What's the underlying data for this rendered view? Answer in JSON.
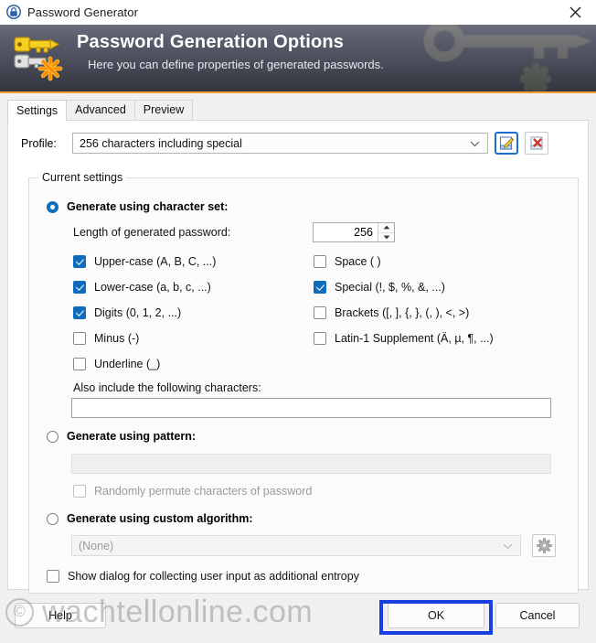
{
  "window": {
    "title": "Password Generator",
    "icon": "padlock-icon",
    "close_label": "✕"
  },
  "banner": {
    "title": "Password Generation Options",
    "subtitle": "Here you can define properties of generated passwords.",
    "icon": "key-star-icon",
    "accent_color": "#f0a030",
    "bg_top": "#6a6d7c",
    "bg_bottom": "#32343d"
  },
  "tabs": [
    {
      "label": "Settings",
      "active": true
    },
    {
      "label": "Advanced",
      "active": false
    },
    {
      "label": "Preview",
      "active": false
    }
  ],
  "profile": {
    "label": "Profile:",
    "value": "256 characters including special",
    "edit_button_icon": "edit-profile-icon",
    "delete_button_icon": "delete-profile-icon"
  },
  "group": {
    "title": "Current settings"
  },
  "charset_option": {
    "label": "Generate using character set:",
    "selected": true,
    "length_label": "Length of generated password:",
    "length_value": "256",
    "checkboxes_left": [
      {
        "label": "Upper-case (A, B, C, ...)",
        "checked": true
      },
      {
        "label": "Lower-case (a, b, c, ...)",
        "checked": true
      },
      {
        "label": "Digits (0, 1, 2, ...)",
        "checked": true
      },
      {
        "label": "Minus (-)",
        "checked": false
      },
      {
        "label": "Underline (_)",
        "checked": false
      }
    ],
    "checkboxes_right": [
      {
        "label": "Space ( )",
        "checked": false
      },
      {
        "label": "Special (!, $, %, &, ...)",
        "checked": true
      },
      {
        "label": "Brackets ([, ], {, }, (, ), <, >)",
        "checked": false
      },
      {
        "label": "Latin-1 Supplement (Ä, µ, ¶, ...)",
        "checked": false
      }
    ],
    "also_include_label": "Also include the following characters:",
    "also_include_value": ""
  },
  "pattern_option": {
    "label": "Generate using pattern:",
    "selected": false,
    "pattern_value": "",
    "permute_label": "Randomly permute characters of password",
    "permute_checked": false
  },
  "custom_option": {
    "label": "Generate using custom algorithm:",
    "selected": false,
    "algorithm_value": "(None)",
    "settings_button_icon": "gear-icon"
  },
  "entropy": {
    "label": "Show dialog for collecting user input as additional entropy",
    "checked": false
  },
  "footer": {
    "help_label": "Help",
    "ok_label": "OK",
    "cancel_label": "Cancel",
    "highlight_target": "OK",
    "highlight_color": "#1a3fe0"
  },
  "watermark": {
    "symbol": "©",
    "text": "wachtellonline.com"
  }
}
